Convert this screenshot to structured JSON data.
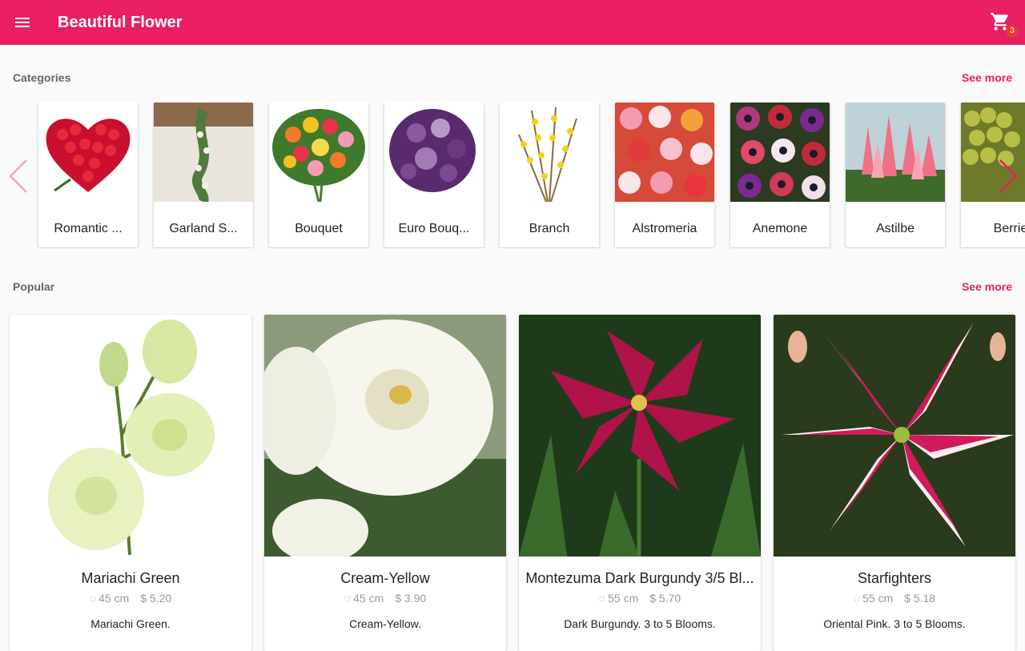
{
  "appbar": {
    "title": "Beautiful Flower",
    "cart_count": "3",
    "color": "#e91e63"
  },
  "categories": {
    "label": "Categories",
    "see_more": "See more",
    "items": [
      {
        "label": "Romantic ...",
        "image": "red-rose-heart"
      },
      {
        "label": "Garland S...",
        "image": "table-garland"
      },
      {
        "label": "Bouquet",
        "image": "mixed-bouquet"
      },
      {
        "label": "Euro Bouq...",
        "image": "purple-roses"
      },
      {
        "label": "Branch",
        "image": "yellow-forsythia"
      },
      {
        "label": "Alstromeria",
        "image": "alstroemeria"
      },
      {
        "label": "Anemone",
        "image": "anemone"
      },
      {
        "label": "Astilbe",
        "image": "astilbe"
      },
      {
        "label": "Berrie",
        "image": "berries"
      }
    ]
  },
  "popular": {
    "label": "Popular",
    "see_more": "See more",
    "items": [
      {
        "name": "Mariachi Green",
        "height": "45 cm",
        "price": "$ 5.20",
        "desc": "Mariachi Green.",
        "image": "green-lisianthus"
      },
      {
        "name": "Cream-Yellow",
        "height": "45 cm",
        "price": "$ 3.90",
        "desc": "Cream-Yellow.",
        "image": "cream-lisianthus"
      },
      {
        "name": "Montezuma Dark Burgundy 3/5 Bl...",
        "height": "55 cm",
        "price": "$ 5.70",
        "desc": "Dark Burgundy. 3 to 5 Blooms.",
        "image": "burgundy-lily"
      },
      {
        "name": "Starfighters",
        "height": "55 cm",
        "price": "$ 5.18",
        "desc": "Oriental Pink. 3 to 5 Blooms.",
        "image": "stargazer-lily"
      }
    ]
  }
}
